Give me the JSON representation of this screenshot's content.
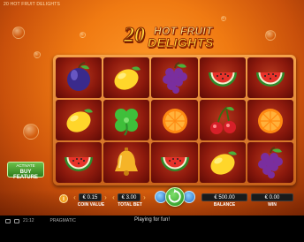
{
  "game": {
    "title": "20 HOT FRUIT DELIGHTS",
    "logo": {
      "number": "20",
      "line1": "HOT FRUIT",
      "line2": "DELIGHTS"
    }
  },
  "reels": [
    [
      "plum",
      "lemon",
      "watermelon"
    ],
    [
      "lemon",
      "clover",
      "bell"
    ],
    [
      "grapes",
      "orange",
      "watermelon"
    ],
    [
      "watermelon",
      "cherries",
      "lemon"
    ],
    [
      "watermelon",
      "orange",
      "grapes"
    ]
  ],
  "buy_feature": {
    "line1": "ACTIVATE",
    "line2": "BUY FEATURE"
  },
  "controls": {
    "info_icon": "i",
    "coin_value": "€ 0.15",
    "coin_value_label": "COIN VALUE",
    "total_bet": "€ 3.00",
    "total_bet_label": "TOTAL BET",
    "balance": "€ 500.00",
    "balance_label": "BALANCE",
    "win": "€ 0.00",
    "win_label": "WIN"
  },
  "status_bar": {
    "time": "21:12",
    "provider": "PRAGMATIC",
    "message": "Playing for fun!"
  },
  "colors": {
    "accent": "#f07a12",
    "spin": "#2e9a22",
    "reel_bg": "#8e1a0d"
  }
}
